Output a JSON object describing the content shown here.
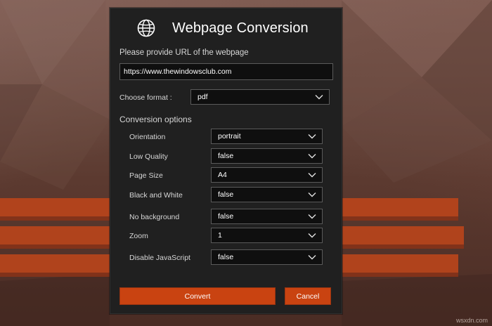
{
  "dialog": {
    "title": "Webpage Conversion",
    "url_label": "Please provide URL of the webpage",
    "url_value": "https://www.thewindowsclub.com",
    "format_label": "Choose format :",
    "format_value": "pdf",
    "conversion_options_label": "Conversion options",
    "options": [
      {
        "label": "Orientation",
        "value": "portrait"
      },
      {
        "label": "Low Quality",
        "value": "false"
      },
      {
        "label": "Page Size",
        "value": "A4"
      },
      {
        "label": "Black and White",
        "value": "false"
      },
      {
        "label": "No background",
        "value": "false"
      },
      {
        "label": "Zoom",
        "value": "1"
      },
      {
        "label": "Disable JavaScript",
        "value": "false"
      }
    ],
    "convert_label": "Convert",
    "cancel_label": "Cancel"
  },
  "watermark": "wsxdn.com",
  "colors": {
    "accent": "#c94311",
    "dialog_background": "#202020",
    "field_background": "#0f0f0f",
    "field_border": "#5a5a5a"
  },
  "icons": {
    "app": "globe-icon",
    "dropdown": "chevron-down-icon"
  }
}
